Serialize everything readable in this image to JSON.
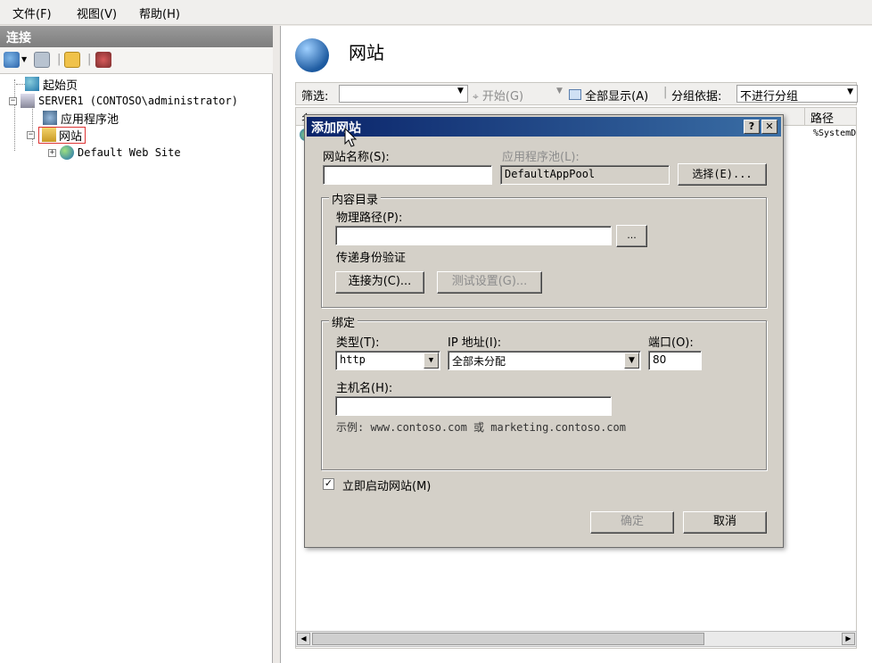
{
  "menubar": {
    "items": [
      "文件(F)",
      "视图(V)",
      "帮助(H)"
    ]
  },
  "connections": {
    "header": "连接",
    "tree": [
      {
        "label": "起始页"
      },
      {
        "label": "SERVER1 (CONTOSO\\administrator)"
      },
      {
        "label": "应用程序池"
      },
      {
        "label": "网站"
      },
      {
        "label": "Default Web Site"
      }
    ]
  },
  "main": {
    "title": "网站",
    "filter_label": "筛选:",
    "start_label": "开始(G)",
    "show_all_label": "全部显示(A)",
    "group_by_label": "分组依据:",
    "group_by_value": "不进行分组",
    "columns": [
      "名",
      "路径"
    ],
    "path_cell": "%SystemD"
  },
  "dialog": {
    "title": "添加网站",
    "help_btn": "?",
    "close_btn": "✕",
    "site_name_label": "网站名称(S):",
    "site_name_value": "",
    "app_pool_label": "应用程序池(L):",
    "app_pool_value": "DefaultAppPool",
    "select_btn": "选择(E)...",
    "content_dir_caption": "内容目录",
    "physical_path_label": "物理路径(P):",
    "physical_path_value": "",
    "browse_btn": "...",
    "pass_through_label": "传递身份验证",
    "connect_as_btn": "连接为(C)...",
    "test_settings_btn": "测试设置(G)...",
    "binding_caption": "绑定",
    "type_label": "类型(T):",
    "type_value": "http",
    "ip_label": "IP 地址(I):",
    "ip_value": "全部未分配",
    "port_label": "端口(O):",
    "port_value": "80",
    "host_label": "主机名(H):",
    "host_value": "",
    "example_text": "示例: www.contoso.com 或 marketing.contoso.com",
    "start_now_label": "立即启动网站(M)",
    "start_now_checked": "✓",
    "ok_btn": "确定",
    "cancel_btn": "取消"
  }
}
